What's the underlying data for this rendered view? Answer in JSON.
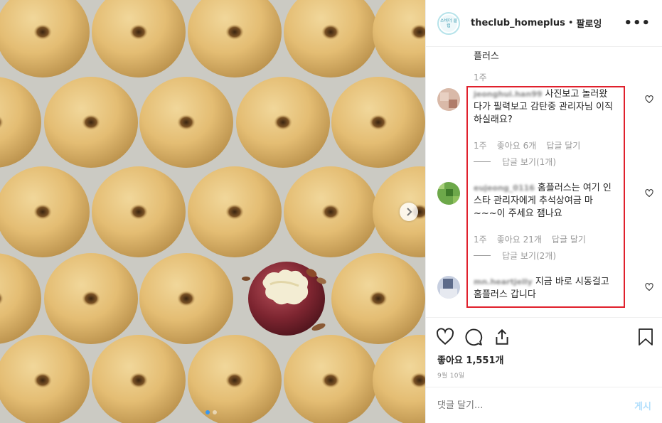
{
  "header": {
    "username": "theclub_homeplus",
    "separator": "•",
    "follow_label": "팔로잉",
    "logo_text": "소비더 클럽"
  },
  "previous_comment": {
    "text_tail": "플러스",
    "time": "1주"
  },
  "comments": [
    {
      "username": "jeonghui.han99",
      "text": "사진보고 놀러왔다가 필력보고 감탄중 관리자님 이직하실래요?",
      "time": "1주",
      "likes": "좋아요 6개",
      "reply_label": "답글 달기",
      "view_replies": "답글 보기(1개)"
    },
    {
      "username": "eujeong_0116",
      "text": "홈플러스는 여기 인스타 관리자에게 추석상여금 마~~~이 주세요 잼나요",
      "time": "1주",
      "likes": "좋아요 21개",
      "reply_label": "답글 달기",
      "view_replies": "답글 보기(2개)"
    },
    {
      "username": "mn.heartjelly",
      "text": "지금 바로 시동걸고 홈플러스 갑니다"
    }
  ],
  "actions": {
    "likes_text": "좋아요 1,551개",
    "date": "9월 10일"
  },
  "comment_box": {
    "placeholder": "댓글 달기...",
    "post_label": "게시"
  },
  "colors": {
    "highlight_border": "#e0202c",
    "accent_blue": "#3897f0",
    "post_button_disabled": "#b2dffc"
  },
  "icons": [
    "heart-icon",
    "comment-icon",
    "share-icon",
    "bookmark-icon",
    "more-options-icon",
    "chevron-right-icon"
  ]
}
